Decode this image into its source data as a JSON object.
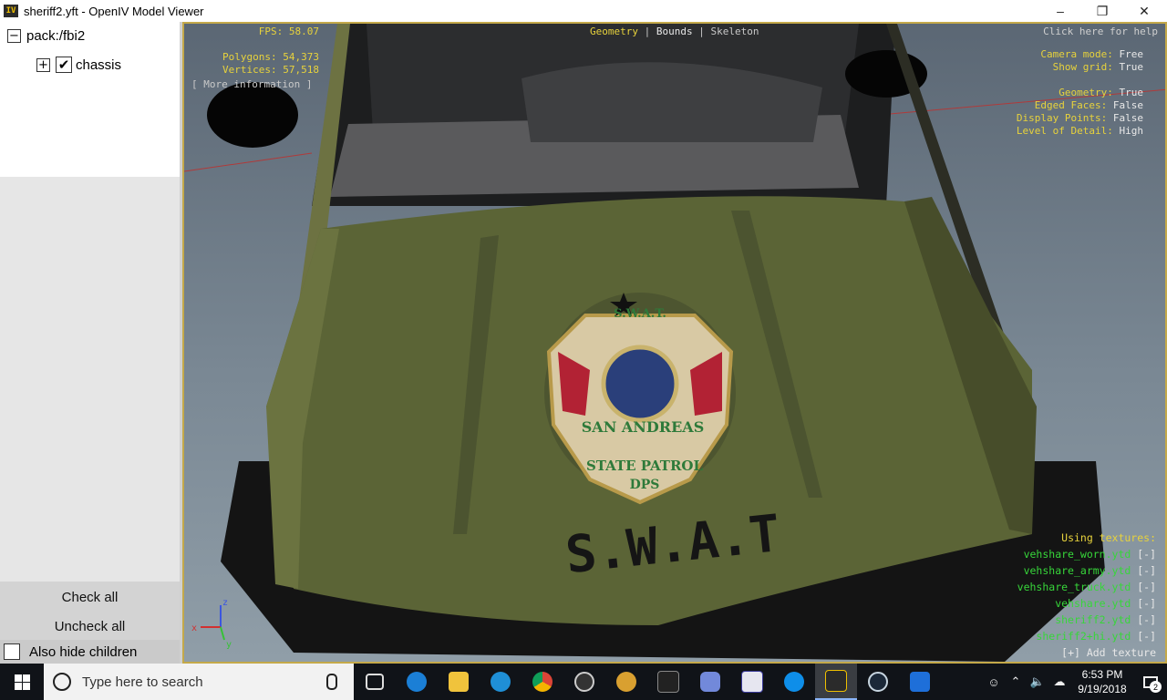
{
  "window": {
    "title": "sheriff2.yft - OpenIV Model Viewer",
    "app_icon": "IV",
    "minimize_icon": "–",
    "maximize_icon": "❐",
    "close_icon": "✕"
  },
  "tree": {
    "root": {
      "expander": "−",
      "label": "pack:/fbi2"
    },
    "child": {
      "expander": "+",
      "checked": "✔",
      "label": "chassis"
    }
  },
  "left_buttons": {
    "check_all": "Check all",
    "uncheck_all": "Uncheck all",
    "also_hide_children": "Also hide children"
  },
  "hud": {
    "fps_label": "FPS:",
    "fps_value": "58.07",
    "polygons_label": "Polygons:",
    "polygons_value": "54,373",
    "vertices_label": "Vertices:",
    "vertices_value": "57,518",
    "more_info": "[ More information ]",
    "tabs": [
      "Geometry",
      "Bounds",
      "Skeleton"
    ],
    "tab_separator": "|",
    "help": "Click here for help",
    "camera_mode_label": "Camera mode:",
    "camera_mode_value": "Free",
    "show_grid_label": "Show grid:",
    "show_grid_value": "True",
    "geometry_label": "Geometry:",
    "geometry_value": "True",
    "edged_faces_label": "Edged Faces:",
    "edged_faces_value": "False",
    "display_points_label": "Display Points:",
    "display_points_value": "False",
    "lod_label": "Level of Detail:",
    "lod_value": "High",
    "using_textures": "Using textures:",
    "textures": [
      "vehshare_worn.ytd",
      "vehshare_army.ytd",
      "vehshare_truck.ytd",
      "vehshare.ytd",
      "sheriff2.ytd",
      "sheriff2+hi.ytd"
    ],
    "remove_mark": "[-]",
    "add_texture": "[+] Add texture"
  },
  "scene": {
    "decal_text": "S.W.A.T",
    "badge_top": "S.W.A.T.",
    "badge_middle": "SAN ANDREAS",
    "badge_lower": "STATE PATROL",
    "badge_bottom": "DPS",
    "axis_z": "z",
    "axis_x": "x",
    "axis_y": "y"
  },
  "taskbar": {
    "search_placeholder": "Type here to search",
    "time": "6:53 PM",
    "date": "9/19/2018",
    "notification_count": "2"
  },
  "colors": {
    "hud_yellow": "#e7d23c",
    "hud_green": "#37d63a",
    "hood_olive": "#5b6436",
    "viewport_border": "#c4a94a"
  }
}
